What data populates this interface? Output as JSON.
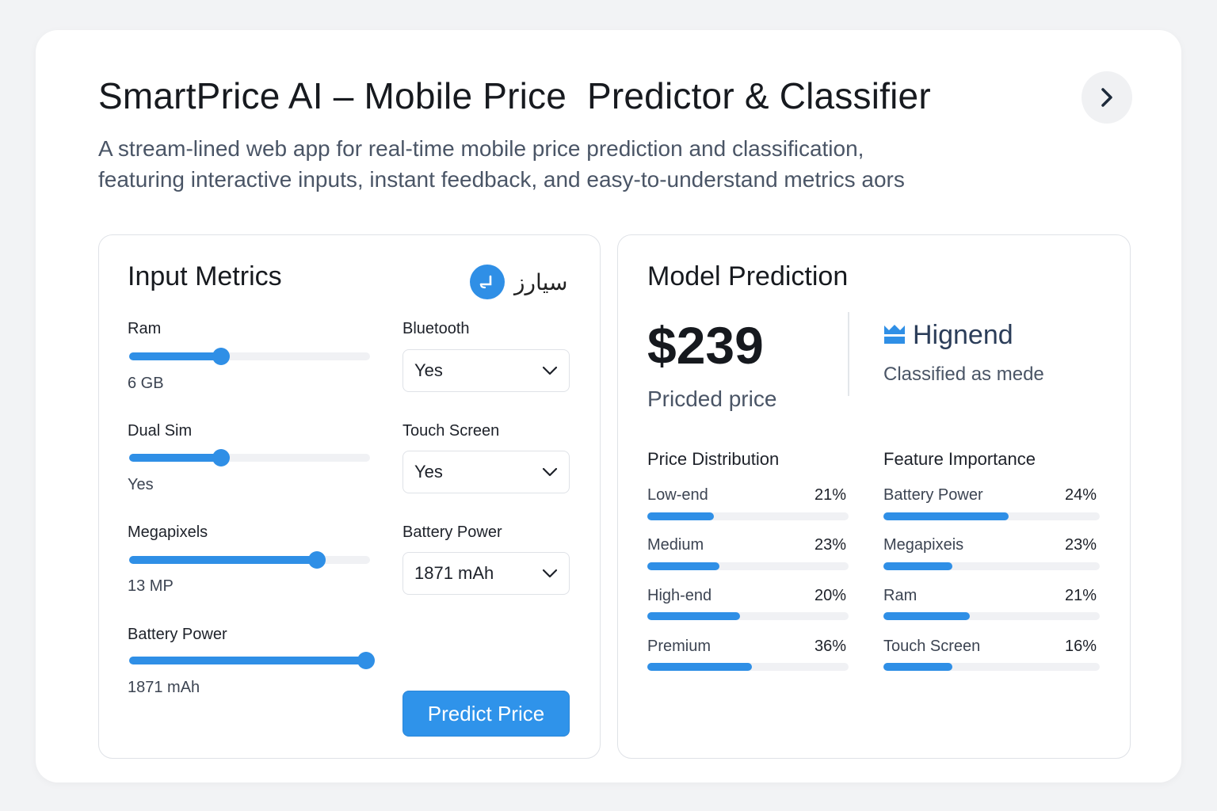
{
  "header": {
    "title": "SmartPrice AI – Mobile Price  Predictor & Classifier",
    "subtitle_line1": "A stream-lined web app for real-time mobile price prediction and classification,",
    "subtitle_line2": "featuring interactive inputs, instant feedback, and easy-to-understand metrics aors",
    "next_icon": "chevron-right-icon"
  },
  "input_panel": {
    "title": "Input Metrics",
    "logo_text": "سيارز",
    "sliders": [
      {
        "label": "Ram",
        "value": "6 GB",
        "fraction": 0.38
      },
      {
        "label": "Dual Sim",
        "value": "Yes",
        "fraction": 0.38
      },
      {
        "label": "Megapixels",
        "value": "13 MP",
        "fraction": 0.78
      },
      {
        "label": "Battery Power",
        "value": "1871 mAh",
        "fraction": 0.985
      }
    ],
    "selects": [
      {
        "label": "Bluetooth",
        "value": "Yes"
      },
      {
        "label": "Touch Screen",
        "value": "Yes"
      },
      {
        "label": "Battery Power",
        "value": "1871 mAh"
      }
    ],
    "predict_label": "Predict Price"
  },
  "prediction_panel": {
    "title": "Model Prediction",
    "price": "$239",
    "price_caption": "Pricded price",
    "class_name": "Hignend",
    "class_caption": "Classified as mede",
    "accent_color": "#2f8fe6",
    "distribution": {
      "title": "Price Distribution",
      "items": [
        {
          "label": "Low-end",
          "pct": "21%",
          "fill": 0.33
        },
        {
          "label": "Medium",
          "pct": "23%",
          "fill": 0.36
        },
        {
          "label": "High-end",
          "pct": "20%",
          "fill": 0.46
        },
        {
          "label": "Premium",
          "pct": "36%",
          "fill": 0.52
        }
      ]
    },
    "importance": {
      "title": "Feature Importance",
      "items": [
        {
          "label": "Battery Power",
          "pct": "24%",
          "fill": 0.58
        },
        {
          "label": "Megapixeis",
          "pct": "23%",
          "fill": 0.32
        },
        {
          "label": "Ram",
          "pct": "21%",
          "fill": 0.4
        },
        {
          "label": "Touch Screen",
          "pct": "16%",
          "fill": 0.32
        }
      ]
    }
  }
}
